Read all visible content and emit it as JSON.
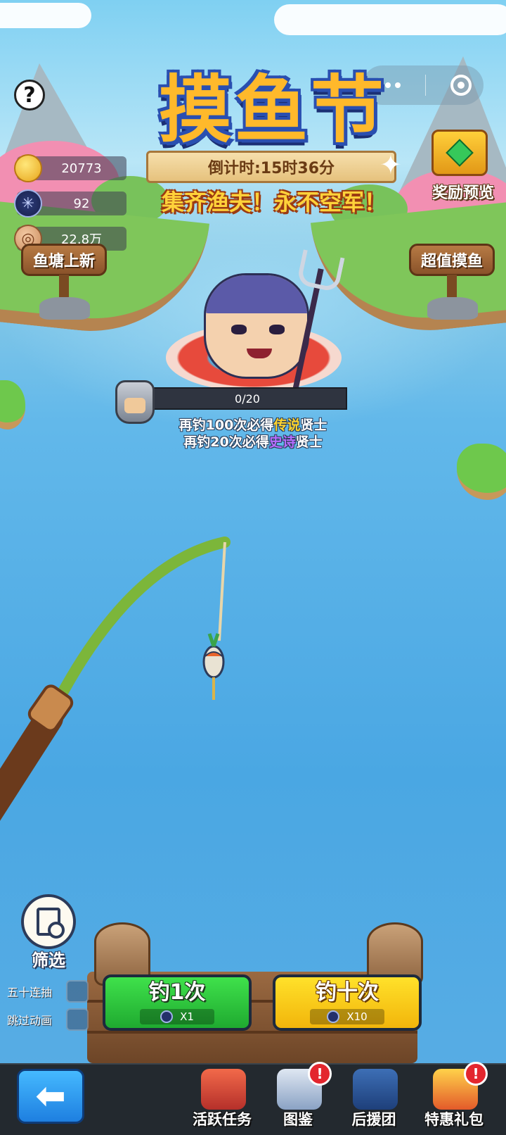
{
  "event": {
    "title": "摸鱼节",
    "countdown": "倒计时:15时36分",
    "slogan": "集齐渔夫！永不空军！"
  },
  "resources": [
    {
      "icon": "gold-ingot-icon",
      "value": "20773"
    },
    {
      "icon": "fishing-net-icon",
      "value": "92"
    },
    {
      "icon": "coin-icon",
      "value": "22.8万"
    }
  ],
  "top_right": {
    "reward_preview_label": "奖励预览"
  },
  "signs": {
    "left": "鱼塘上新",
    "right": "超值摸鱼"
  },
  "progress": {
    "current": 0,
    "total": 20,
    "text": "0/20",
    "legend_prefix": "再钓100次必得",
    "legend_word": "传说",
    "legend_suffix": "贤士",
    "epic_prefix": "再钓20次必得",
    "epic_word": "史诗",
    "epic_suffix": "贤士"
  },
  "filter": {
    "label": "筛选"
  },
  "toggles": [
    {
      "label": "五十连抽"
    },
    {
      "label": "跳过动画"
    }
  ],
  "actions": {
    "single": {
      "title": "钓1次",
      "cost": "X1"
    },
    "ten": {
      "title": "钓十次",
      "cost": "X10"
    }
  },
  "bottom_nav": [
    {
      "label": "活跃任务",
      "alert": false
    },
    {
      "label": "图鉴",
      "alert": true,
      "badge": "!"
    },
    {
      "label": "后援团",
      "alert": false
    },
    {
      "label": "特惠礼包",
      "alert": true,
      "badge": "!"
    }
  ],
  "colors": {
    "green_button": "#2ccb3c",
    "yellow_button": "#fbcc1b",
    "legend": "#ffd52e",
    "epic": "#b66dff",
    "alert": "#e3262e"
  }
}
